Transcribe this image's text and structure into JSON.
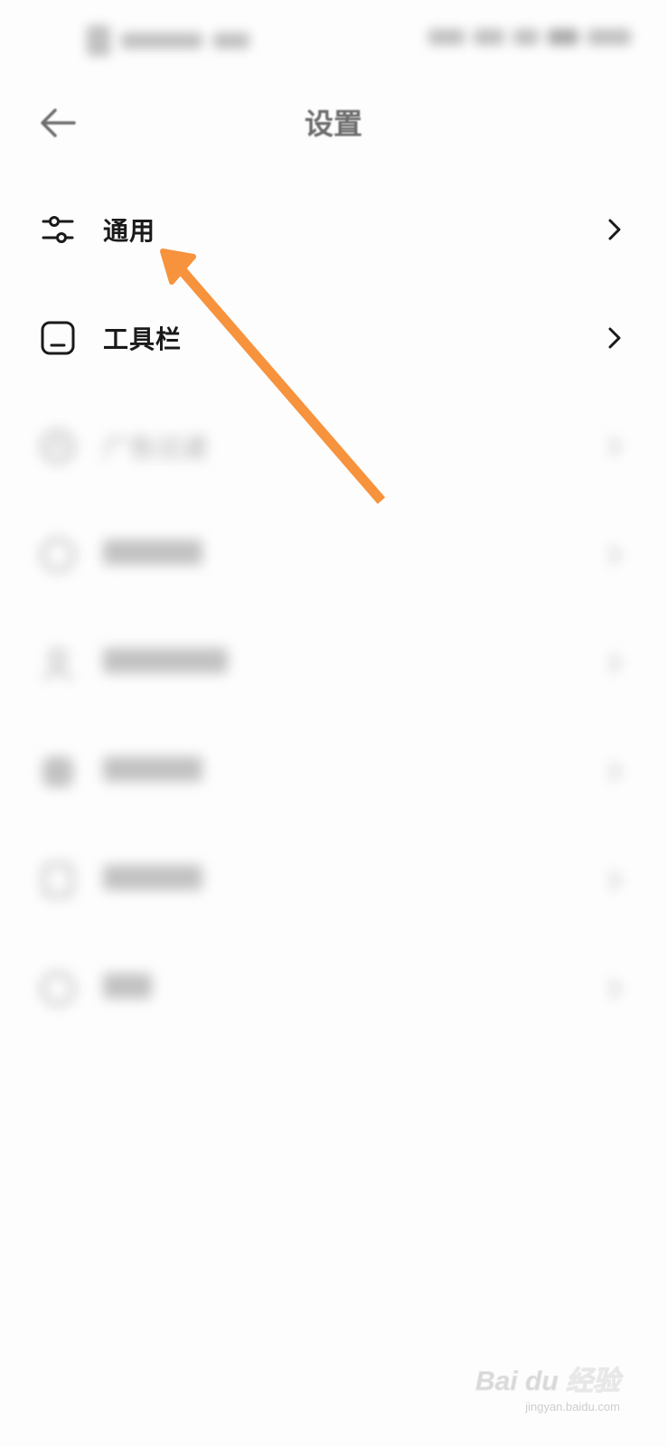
{
  "status_bar": {
    "left_text": "",
    "right_text": ""
  },
  "header": {
    "title": "设置",
    "back_icon": "arrow-left-icon"
  },
  "settings": {
    "items": [
      {
        "label": "通用",
        "icon": "sliders-icon",
        "visible": true
      },
      {
        "label": "工具栏",
        "icon": "toolbar-icon",
        "visible": true
      },
      {
        "label": "广告过滤",
        "icon": "ad-filter-icon",
        "visible": false
      },
      {
        "label": "",
        "icon": "item-icon",
        "visible": false
      },
      {
        "label": "",
        "icon": "user-icon",
        "visible": false
      },
      {
        "label": "",
        "icon": "item-icon",
        "visible": false
      },
      {
        "label": "",
        "icon": "item-icon",
        "visible": false
      },
      {
        "label": "",
        "icon": "info-icon",
        "visible": false
      }
    ]
  },
  "annotation": {
    "color": "#f7923d",
    "target": "通用"
  },
  "watermark": {
    "text": "Bai du 经验",
    "sub": "jingyan.baidu.com"
  },
  "colors": {
    "background": "#fdfdfd",
    "text": "#1a1a1a",
    "title": "#6c6c6c",
    "arrow": "#f7923d"
  }
}
